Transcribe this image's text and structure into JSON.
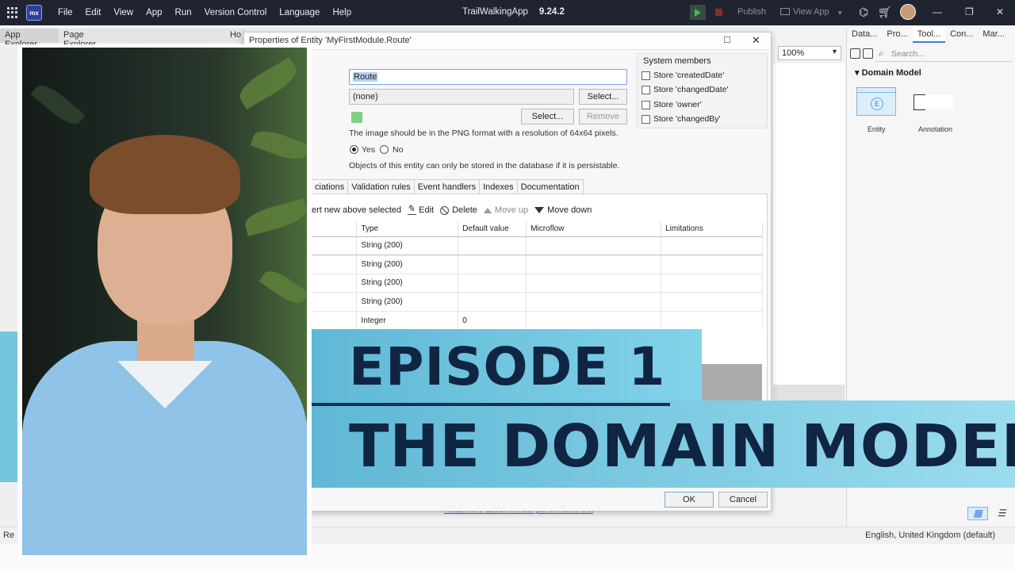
{
  "titlebar": {
    "menus": [
      "File",
      "Edit",
      "View",
      "App",
      "Run",
      "Version Control",
      "Language",
      "Help"
    ],
    "app_name": "TrailWalkingApp",
    "version": "9.24.2",
    "publish": "Publish",
    "view_app": "View App",
    "logo": "mx"
  },
  "left_tabs": [
    "App Explorer",
    "Page Explorer",
    "Ho"
  ],
  "zoom": "100%",
  "right_panel": {
    "tabs": [
      "Data...",
      "Pro...",
      "Tool...",
      "Con...",
      "Mar..."
    ],
    "search_placeholder": "Search...",
    "section": "Domain Model",
    "tiles": [
      "Entity",
      "Annotation"
    ]
  },
  "dialog": {
    "title": "Properties of Entity 'MyFirstModule.Route'",
    "name_value": "Route",
    "generalization": "(none)",
    "select_label": "Select...",
    "remove_label": "Remove",
    "image_hint": "The image should be in the PNG format with a resolution of 64x64 pixels.",
    "persist_yes": "Yes",
    "persist_no": "No",
    "persist_hint": "Objects of this entity can only be stored in the database if it is persistable.",
    "system_members": {
      "title": "System members",
      "items": [
        "Store 'createdDate'",
        "Store 'changedDate'",
        "Store 'owner'",
        "Store 'changedBy'"
      ]
    },
    "tabs": [
      "ciations",
      "Validation rules",
      "Event handlers",
      "Indexes",
      "Documentation"
    ],
    "toolbar": {
      "insert": "ert new above selected",
      "edit": "Edit",
      "delete": "Delete",
      "move_up": "Move up",
      "move_down": "Move down"
    },
    "table": {
      "headers": [
        "",
        "Type",
        "Default value",
        "Microflow",
        "Limitations"
      ],
      "rows": [
        [
          "",
          "String (200)",
          "",
          "",
          ""
        ],
        [
          "",
          "String (200)",
          "",
          "",
          ""
        ],
        [
          "",
          "String (200)",
          "",
          "",
          ""
        ],
        [
          "",
          "String (200)",
          "",
          "",
          ""
        ],
        [
          "",
          "Integer",
          "0",
          "",
          ""
        ]
      ]
    },
    "ok": "OK",
    "cancel": "Cancel"
  },
  "status": {
    "language": "English, United Kingdom (default)",
    "left": "Re",
    "perf_link": "Read more about Mendix performance bot"
  },
  "thumbnail": {
    "line1": "EPISODE 1",
    "line2": "THE DOMAIN MODEL"
  },
  "colors": {
    "banner": "#5fb8d5",
    "banner_text": "#0f2542",
    "titlebar": "#1f2430"
  }
}
